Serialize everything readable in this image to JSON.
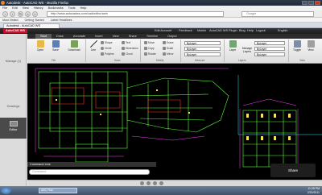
{
  "browser": {
    "title": "Autodesk - AutoCAD WS - Mozilla Firefox",
    "menu": [
      "File",
      "Edit",
      "View",
      "History",
      "Bookmarks",
      "Tools",
      "Help"
    ],
    "url": "http://www.autocadws.com/cad/editor/web",
    "search_placeholder": "Google",
    "bookmarks": [
      "Most Visited",
      "Getting Started",
      "Latest Headlines"
    ],
    "tab_label": "Autodesk - AutoCAD WS"
  },
  "app": {
    "logo": "AutoCAD WS",
    "links": [
      "Edit Account",
      "Feedback",
      "Mobile",
      "AutoCAD WS Plugin",
      "Blog",
      "Help",
      "Logout"
    ],
    "language": "English"
  },
  "sidebar": {
    "items": [
      {
        "label": "Manage (1)"
      },
      {
        "label": "Drawings"
      },
      {
        "label": "Editor"
      }
    ]
  },
  "ribbon": {
    "tabs": [
      "Start",
      "Draw",
      "Annotate",
      "Insert",
      "View",
      "Share",
      "Timeline",
      "Output"
    ],
    "active_tab": "Start",
    "file": {
      "open": "Open",
      "save": "Save",
      "download": "Download"
    },
    "draw": {
      "line": "Line",
      "shape": "Shape",
      "circle": "Circle",
      "polyline": "Polyline",
      "text": "Text",
      "dimension": "Dimension",
      "cloud": "Cloud"
    },
    "modify": {
      "move": "Move",
      "copy": "Copy",
      "rotate": "Rotate",
      "erase": "Erase",
      "scale": "Scale",
      "mirror": "Mirror"
    },
    "group_labels": {
      "file": "File",
      "draw": "Draw",
      "modify": "Modify",
      "layers": "Layers",
      "view": "View"
    },
    "properties": {
      "color_value": "ByLayer",
      "linetype_value": "ByLayer",
      "lineweight_value": "ByLayer",
      "measure_label": "Measure"
    },
    "layers": {
      "layer_label": "Layer",
      "manage_label": "Manage Layers"
    },
    "view": {
      "zoom_label": "View",
      "toggle_label": "Toggle"
    }
  },
  "command": {
    "label": "Command Line",
    "placeholder": "Command:"
  },
  "share_button": "Share",
  "taskbar": {
    "task": "ABC Plan",
    "time": "11:28 PM",
    "date": "2/20/2011"
  },
  "colors": {
    "canvas_bg": "#000000",
    "line_green": "#5eff3a",
    "line_magenta": "#ff3cff",
    "line_red": "#ff3030",
    "line_yellow": "#ffe14a",
    "line_cyan": "#3ce5ff"
  }
}
